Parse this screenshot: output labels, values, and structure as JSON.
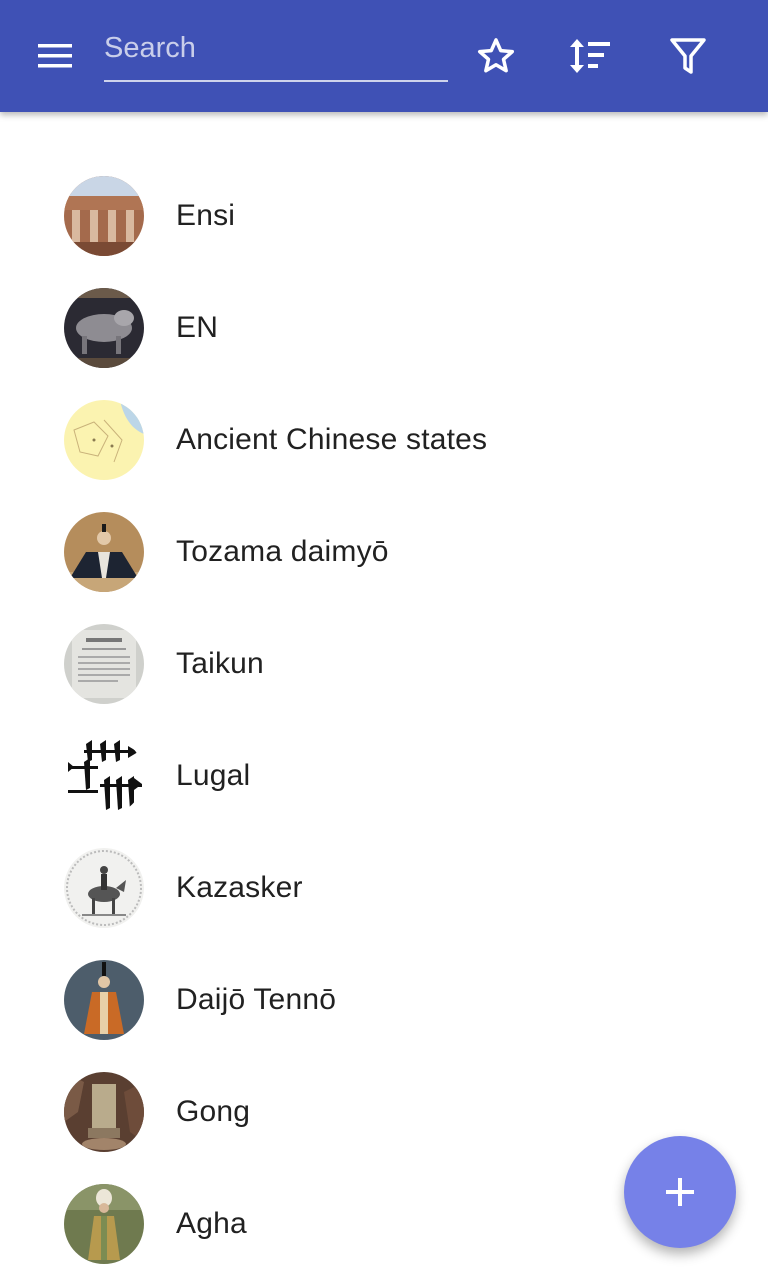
{
  "app_bar": {
    "search_placeholder": "Search",
    "search_value": "",
    "menu_icon": "hamburger-menu-icon",
    "favorite_icon": "star-outline-icon",
    "sort_icon": "sort-icon",
    "filter_icon": "filter-icon",
    "color": "#3f51b5"
  },
  "list": {
    "items": [
      {
        "label": "Ensi",
        "avatar": "ruins-columns-image"
      },
      {
        "label": "EN",
        "avatar": "relief-sculpture-image"
      },
      {
        "label": "Ancient Chinese states",
        "avatar": "map-image"
      },
      {
        "label": "Tozama daimyō",
        "avatar": "daimyo-portrait-image"
      },
      {
        "label": "Taikun",
        "avatar": "document-image"
      },
      {
        "label": "Lugal",
        "avatar": "cuneiform-glyph-image"
      },
      {
        "label": "Kazasker",
        "avatar": "horseman-engraving-image"
      },
      {
        "label": "Daijō Tennō",
        "avatar": "emperor-robes-image"
      },
      {
        "label": "Gong",
        "avatar": "stone-stele-image"
      },
      {
        "label": "Agha",
        "avatar": "ottoman-figure-image"
      }
    ]
  },
  "fab": {
    "icon": "plus-icon",
    "color": "#7681e8"
  }
}
